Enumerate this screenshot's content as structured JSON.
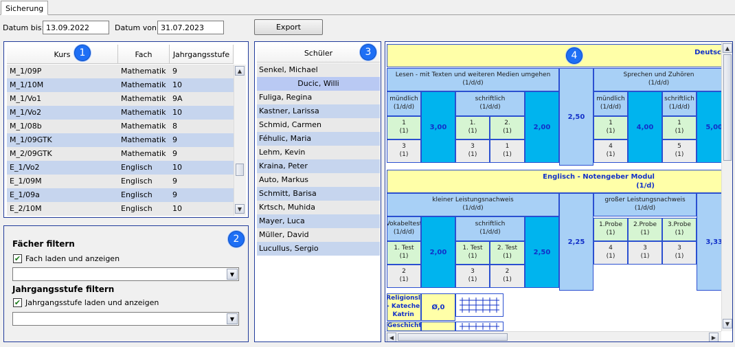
{
  "tab": {
    "label": "Sicherung"
  },
  "toolbar": {
    "datum_bis_label": "Datum bis:",
    "datum_bis_value": "13.09.2022",
    "datum_von_label": "Datum von:",
    "datum_von_value": "31.07.2023",
    "export_label": "Export"
  },
  "badges": {
    "one": "1",
    "two": "2",
    "three": "3",
    "four": "4"
  },
  "kurs_table": {
    "headers": {
      "kurs": "Kurs",
      "fach": "Fach",
      "stufe": "Jahrgangsstufe"
    },
    "rows": [
      {
        "kurs": "M_1/09P",
        "fach": "Mathematik",
        "stufe": "9"
      },
      {
        "kurs": "M_1/10M",
        "fach": "Mathematik",
        "stufe": "10"
      },
      {
        "kurs": "M_1/Vo1",
        "fach": "Mathematik",
        "stufe": "9A"
      },
      {
        "kurs": "M_1/Vo2",
        "fach": "Mathematik",
        "stufe": "10"
      },
      {
        "kurs": "M_1/08b",
        "fach": "Mathematik",
        "stufe": "8"
      },
      {
        "kurs": "M_1/09GTK",
        "fach": "Mathematik",
        "stufe": "9"
      },
      {
        "kurs": "M_2/09GTK",
        "fach": "Mathematik",
        "stufe": "9"
      },
      {
        "kurs": "E_1/Vo2",
        "fach": "Englisch",
        "stufe": "10"
      },
      {
        "kurs": "E_1/09M",
        "fach": "Englisch",
        "stufe": "9"
      },
      {
        "kurs": "E_1/09a",
        "fach": "Englisch",
        "stufe": "9"
      },
      {
        "kurs": "E_2/10M",
        "fach": "Englisch",
        "stufe": "10"
      }
    ]
  },
  "filter": {
    "faecher_title": "Fächer filtern",
    "faecher_checkbox": "Fach laden und anzeigen",
    "stufe_title": "Jahrgangsstufe filtern",
    "stufe_checkbox": "Jahrgangsstufe laden und anzeigen"
  },
  "schueler": {
    "header": "Schüler",
    "rows": [
      "Senkel, Michael",
      "Ducic, Willi",
      "Fuliga, Regina",
      "Kastner, Larissa",
      "Schmid, Carmen",
      "Féhulic, Maria",
      "Lehm, Kevin",
      "Kraina, Peter",
      "Auto, Markus",
      "Schmitt, Barisa",
      "Krtsch, Muhida",
      "Mayer, Luca",
      "Müller, David",
      "Lucullus, Sergio"
    ]
  },
  "noten": {
    "deutsch_title": "Deutsc",
    "lesen_title": "Lesen - mit Texten und weiteren Medien umgehen",
    "lesen_sub": "(1/d/d)",
    "muendlich": "mündlich",
    "muendlich_sub": "(1/d/d)",
    "schriftlich": "schriftlich",
    "schriftlich_sub": "(1/d/d)",
    "g1": "1",
    "g1s": "(1)",
    "g3": "3",
    "g3s": "(1)",
    "avg_300": "3,00",
    "s1": "1.",
    "s1s": "(1)",
    "s2": "2.",
    "s2s": "(1)",
    "s3": "3",
    "s3s": "(1)",
    "s4": "1",
    "s4s": "(1)",
    "avg_200": "2,00",
    "avg_250": "2,50",
    "sprechen_title": "Sprechen und Zuhören",
    "sprechen_sub": "(1/d/d)",
    "sp_m1": "1",
    "sp_m1s": "(1)",
    "sp_m2": "4",
    "sp_m2s": "(1)",
    "avg_400": "4,00",
    "sp_s1": "1",
    "sp_s1s": "(1)",
    "sp_s2": "5",
    "sp_s2s": "(1)",
    "avg_500": "5,00",
    "englisch_title": "Englisch - Notengeber Modul",
    "englisch_sub": "(1/d)",
    "kleiner": "kleiner Leistungsnachweis",
    "kleiner_sub": "(1/d/d)",
    "vokabeltest": "Vokabeltest",
    "vokabeltest_sub": "(1/d/d)",
    "e_schriftlich": "schriftlich",
    "e_schriftlich_sub": "(1/d/d)",
    "test1": "1. Test",
    "test1s": "(1)",
    "test2": "2",
    "test2s": "(1)",
    "avg_e200": "2,00",
    "et1": "1. Test",
    "et1s": "(1)",
    "et2": "2. Test",
    "et2s": "(1)",
    "et3": "3",
    "et3s": "(1)",
    "et4": "2",
    "et4s": "(1)",
    "avg_e250": "2,50",
    "avg_e225": "2,25",
    "grosser": "großer Leistungsnachweis",
    "grosser_sub": "(1/d/d)",
    "p1": "1.Probe",
    "p1s": "(1)",
    "p2": "2.Probe",
    "p2s": "(1)",
    "p3": "3.Probe",
    "p3s": "(1)",
    "pv1": "4",
    "pv1s": "(1)",
    "pv2": "3",
    "pv2s": "(1)",
    "pv3": "3",
    "pv3s": "(1)",
    "avg_e333": "3,33",
    "religion": "Religionsl - Kateche Katrin",
    "religion_avg": "Ø,0",
    "geschichte": "Geschichte"
  }
}
